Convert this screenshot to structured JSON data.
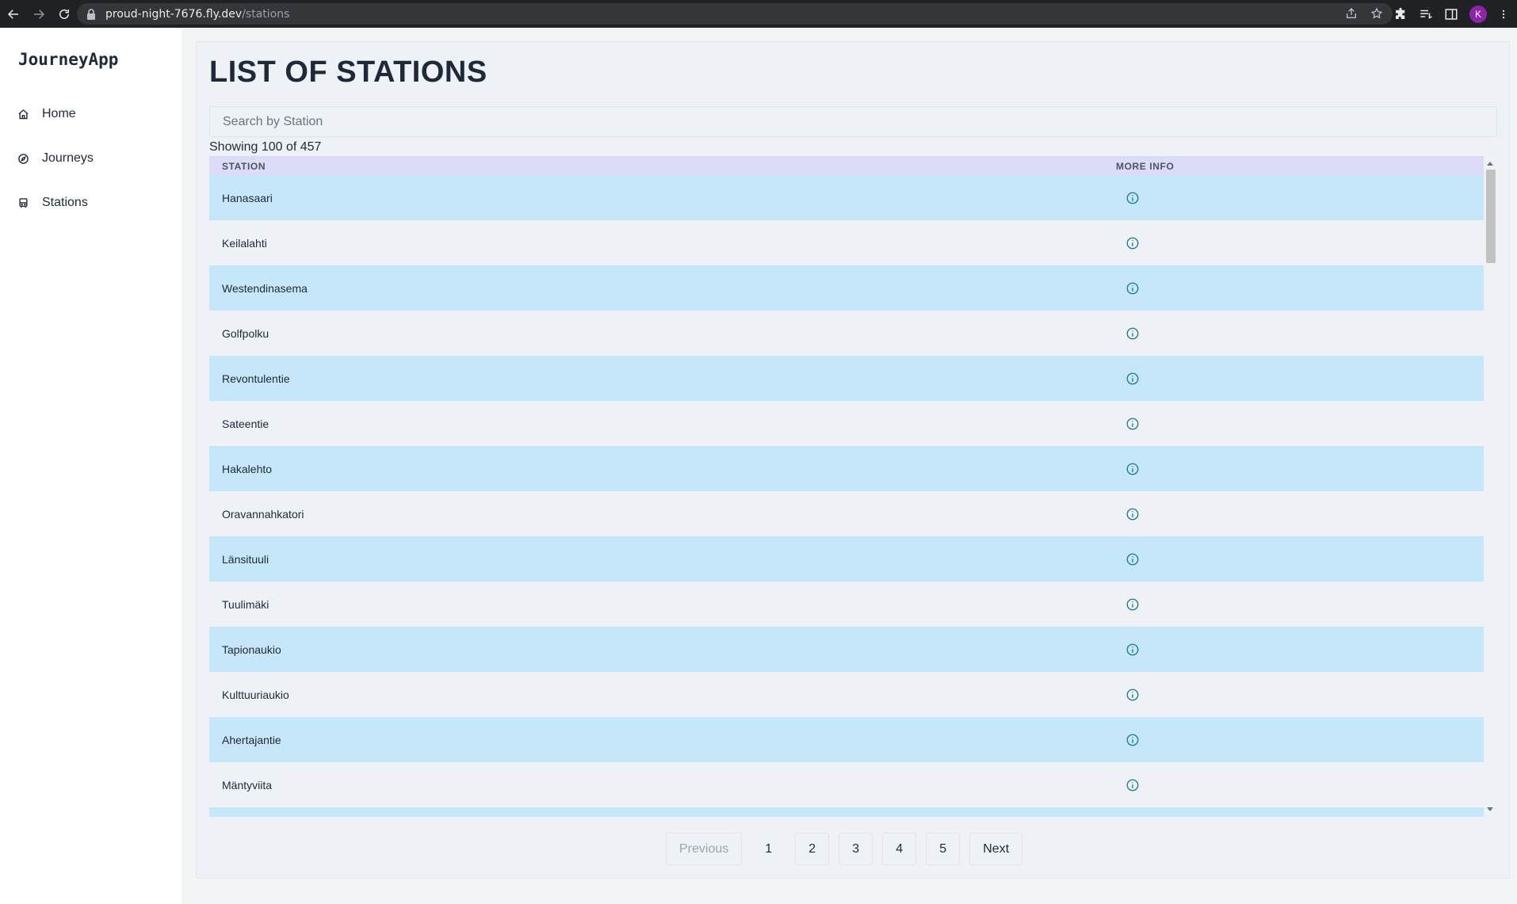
{
  "browser": {
    "url_host": "proud-night-7676.fly.dev",
    "url_path": "/stations",
    "profile_initial": "K"
  },
  "sidebar": {
    "brand": "JourneyApp",
    "items": [
      {
        "label": "Home",
        "icon": "home-icon"
      },
      {
        "label": "Journeys",
        "icon": "compass-icon"
      },
      {
        "label": "Stations",
        "icon": "bus-icon"
      }
    ]
  },
  "main": {
    "title": "LIST OF STATIONS",
    "search_placeholder": "Search by Station",
    "showing_text": "Showing 100 of 457",
    "table": {
      "columns": [
        "STATION",
        "MORE INFO"
      ],
      "rows": [
        "Hanasaari",
        "Keilalahti",
        "Westendinasema",
        "Golfpolku",
        "Revontulentie",
        "Sateentie",
        "Hakalehto",
        "Oravannahkatori",
        "Länsituuli",
        "Tuulimäki",
        "Tapionaukio",
        "Kulttuuriaukio",
        "Ahertajantie",
        "Mäntyviita"
      ]
    },
    "pagination": {
      "previous": "Previous",
      "pages": [
        "1",
        "2",
        "3",
        "4",
        "5"
      ],
      "next": "Next"
    }
  },
  "colors": {
    "row_odd": "#c6e6f9",
    "row_even": "#eef2f7",
    "header": "#dcdcf9",
    "info_icon": "#1e7a8a"
  }
}
